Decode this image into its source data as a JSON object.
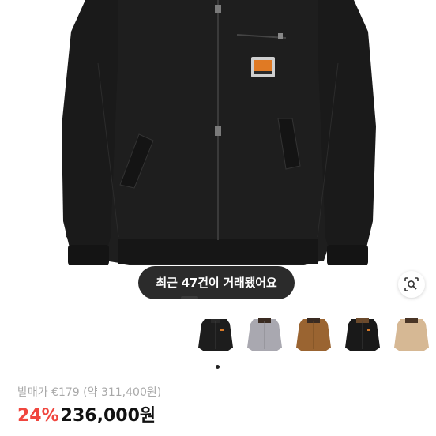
{
  "toast": {
    "text": "최근 47건이 거래됐어요"
  },
  "product": {
    "original_label": "발매가 €179 (약 311,400원)",
    "discount": "24%",
    "price": "236,000원"
  },
  "thumbnails": [
    {
      "name": "black"
    },
    {
      "name": "grey"
    },
    {
      "name": "brown"
    },
    {
      "name": "black-brown-collar"
    },
    {
      "name": "beige"
    }
  ],
  "colors": {
    "discount": "#f0463e",
    "toast_bg": "#2b2b2b",
    "jacket": "#1e1e1e"
  }
}
